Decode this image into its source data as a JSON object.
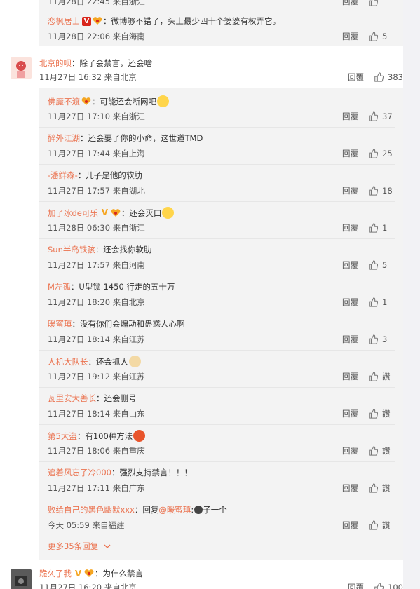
{
  "top_partial": {
    "meta": "11月28日 22:45 来自浙江"
  },
  "first_reply": {
    "name": "恋枫居士",
    "text": "：微博够不错了，头上最少四十个婆婆有权弄它。",
    "time": "11月28日 22:06 来自海南",
    "reply": "回覆",
    "likes": "5"
  },
  "main_comment": {
    "name": "北京的呗",
    "text": "：除了会禁言，还会啥",
    "time": "11月27日 16:32 来自北京",
    "reply": "回覆",
    "likes": "383"
  },
  "sub_replies": [
    {
      "name": "佛魔不渡",
      "text": "：可能还会断网吧",
      "time": "11月27日 17:10 来自浙江",
      "reply": "回覆",
      "likes": "37"
    },
    {
      "name": "醉外江湖",
      "text": "：还会要了你的小命，这世道TMD",
      "time": "11月27日 17:44 来自上海",
      "reply": "回覆",
      "likes": "25"
    },
    {
      "name": "-潘鲜森-",
      "text": "：儿子是他的软肋",
      "time": "11月27日 17:57 来自湖北",
      "reply": "回覆",
      "likes": "18"
    },
    {
      "name": "加了冰de可乐",
      "text": "：还会灭口",
      "time": "11月28日 06:30 来自浙江",
      "reply": "回覆",
      "likes": "1"
    },
    {
      "name": "Sun半岛铁孩",
      "text": "：还会找你软肋",
      "time": "11月27日 17:57 来自河南",
      "reply": "回覆",
      "likes": "5"
    },
    {
      "name": "M左孤",
      "text": "：U型锁 1450 行走的五十万",
      "time": "11月27日 18:20 来自北京",
      "reply": "回覆",
      "likes": "1"
    },
    {
      "name": "暖蜜瑱",
      "text": "：没有你们会煽动和蛊惑人心啊",
      "time": "11月27日 18:14 来自江苏",
      "reply": "回覆",
      "likes": "3"
    },
    {
      "name": "人机大队长",
      "text": "：还会抓人",
      "time": "11月27日 19:12 来自江苏",
      "reply": "回覆",
      "likes": "讚"
    },
    {
      "name": "瓦里安大善长",
      "text": "：还会删号",
      "time": "11月27日 18:14 来自山东",
      "reply": "回覆",
      "likes": "讚"
    },
    {
      "name": "第5大盗",
      "text": "：有100种方法",
      "time": "11月27日 18:06 来自重庆",
      "reply": "回覆",
      "likes": "讚"
    },
    {
      "name": "追着风忘了冷000",
      "text": "：强烈支持禁言！！！",
      "time": "11月27日 17:11 来自广东",
      "reply": "回覆",
      "likes": "讚"
    },
    {
      "name": "败给自己的黑色幽默xxx",
      "text_prefix": "：回复",
      "mention": "@暖蜜瑱",
      "text": ":",
      "text_suffix": "子一个",
      "time": "今天 05:59 来自福建",
      "reply": "回覆",
      "likes": "讚"
    }
  ],
  "more": {
    "label": "更多35条回复"
  },
  "bottom_comment": {
    "name": "跪久了我",
    "text": "：为什么禁言",
    "time": "11月27日 16:20 来自北京",
    "likes": "100"
  },
  "icons": {
    "thumb": "thumbs-up-icon",
    "chevron": "chevron-down-icon"
  },
  "colors": {
    "name": "#eb7350",
    "reply_bg": "#f3f3f3",
    "page_bg": "#f2f2f5",
    "verified_red": "#d9261c",
    "verified_gold": "#f5a623"
  }
}
